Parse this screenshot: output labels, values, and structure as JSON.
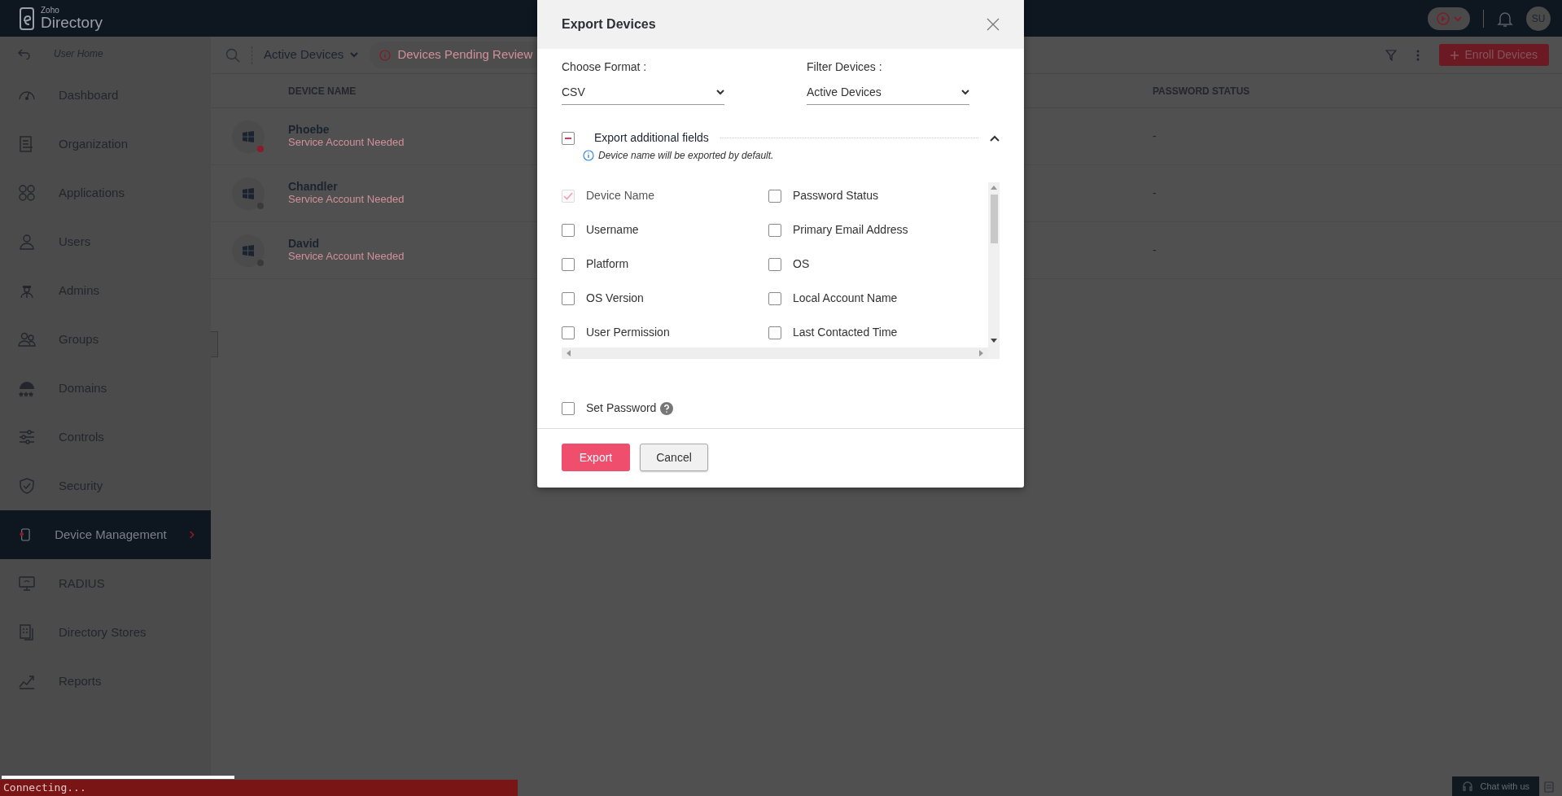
{
  "header": {
    "logo_small": "Zoho",
    "logo": "Directory",
    "avatar": "SU"
  },
  "sidebar": {
    "back": "User Home",
    "items": [
      {
        "label": "Dashboard",
        "selected": false
      },
      {
        "label": "Organization",
        "selected": false
      },
      {
        "label": "Applications",
        "selected": false
      },
      {
        "label": "Users",
        "selected": false
      },
      {
        "label": "Admins",
        "selected": false
      },
      {
        "label": "Groups",
        "selected": false
      },
      {
        "label": "Domains",
        "selected": false
      },
      {
        "label": "Controls",
        "selected": false
      },
      {
        "label": "Security",
        "selected": false
      },
      {
        "label": "Device Management",
        "selected": true
      },
      {
        "label": "RADIUS",
        "selected": false
      },
      {
        "label": "Directory Stores",
        "selected": false
      },
      {
        "label": "Reports",
        "selected": false
      }
    ]
  },
  "toolbar": {
    "view": "Active Devices",
    "pending": "Devices Pending Review",
    "enroll": "Enroll Devices"
  },
  "table": {
    "columns": [
      "DEVICE NAME",
      "PASSWORD STATUS"
    ],
    "rows": [
      {
        "name": "Phoebe",
        "status": "Service Account Needed",
        "color": "#8a1c28",
        "password": "-"
      },
      {
        "name": "Chandler",
        "status": "Service Account Needed",
        "color": "#3a3a3a",
        "password": "-"
      },
      {
        "name": "David",
        "status": "Service Account Needed",
        "color": "#3a3a3a",
        "password": "-"
      }
    ]
  },
  "modal": {
    "title": "Export Devices",
    "format_label": "Choose Format :",
    "format_value": "CSV",
    "filter_label": "Filter Devices :",
    "filter_value": "Active Devices",
    "section": {
      "label": "Export additional fields",
      "partial": true,
      "expanded": true
    },
    "note": "Device name will be exported by default.",
    "fields": [
      {
        "label": "Device Name",
        "checked": true,
        "disabled": true
      },
      {
        "label": "Password Status",
        "checked": false,
        "disabled": false
      },
      {
        "label": "Username",
        "checked": false,
        "disabled": false
      },
      {
        "label": "Primary Email Address",
        "checked": false,
        "disabled": false
      },
      {
        "label": "Platform",
        "checked": false,
        "disabled": false
      },
      {
        "label": "OS",
        "checked": false,
        "disabled": false
      },
      {
        "label": "OS Version",
        "checked": false,
        "disabled": false
      },
      {
        "label": "Local Account Name",
        "checked": false,
        "disabled": false
      },
      {
        "label": "User Permission",
        "checked": false,
        "disabled": false
      },
      {
        "label": "Last Contacted Time",
        "checked": false,
        "disabled": false
      }
    ],
    "set_password": {
      "label": "Set Password",
      "checked": false
    },
    "buttons": {
      "primary": "Export",
      "secondary": "Cancel"
    }
  },
  "status_bar": {
    "connection": "Connecting...",
    "chat": "Chat with us"
  }
}
